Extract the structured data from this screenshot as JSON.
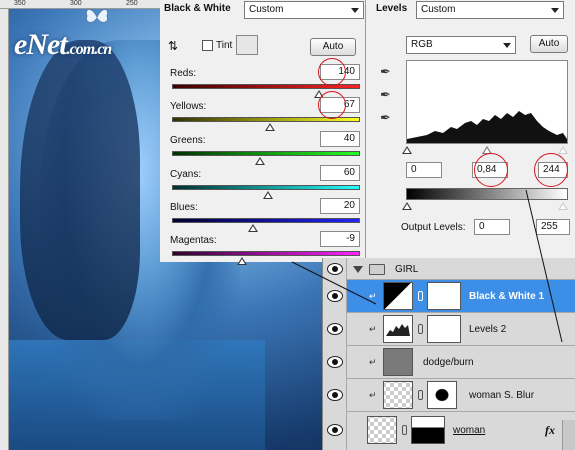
{
  "watermark": {
    "logo": "eNet",
    "domain": ".com.cn"
  },
  "ruler": {
    "ticks": [
      "350",
      "300",
      "250"
    ]
  },
  "bw_panel": {
    "title": "Black & White",
    "preset": "Custom",
    "tint_label": "Tint",
    "auto_label": "Auto",
    "sliders": [
      {
        "label": "Reds:",
        "value": "140",
        "level": 0.78,
        "gradient": [
          "#3a0000",
          "#ff2222"
        ]
      },
      {
        "label": "Yellows:",
        "value": "67",
        "level": 0.52,
        "gradient": [
          "#303000",
          "#ffff22"
        ]
      },
      {
        "label": "Greens:",
        "value": "40",
        "level": 0.47,
        "gradient": [
          "#003000",
          "#22ff22"
        ]
      },
      {
        "label": "Cyans:",
        "value": "60",
        "level": 0.51,
        "gradient": [
          "#003030",
          "#22ffff"
        ]
      },
      {
        "label": "Blues:",
        "value": "20",
        "level": 0.43,
        "gradient": [
          "#000030",
          "#2222ff"
        ]
      },
      {
        "label": "Magentas:",
        "value": "-9",
        "level": 0.37,
        "gradient": [
          "#300030",
          "#ff22ff"
        ]
      }
    ]
  },
  "levels_panel": {
    "title": "Levels",
    "preset": "Custom",
    "channel": "RGB",
    "auto_label": "Auto",
    "input_black": "0",
    "input_gamma": "0,84",
    "input_white": "244",
    "output_label": "Output Levels:",
    "output_black": "0",
    "output_white": "255"
  },
  "layers": [
    {
      "name": "GIRL",
      "type": "group"
    },
    {
      "name": "Black & White 1",
      "type": "adjustment",
      "selected": true
    },
    {
      "name": "Levels 2",
      "type": "adjustment"
    },
    {
      "name": "dodge/burn",
      "type": "pixel"
    },
    {
      "name": "woman S. Blur",
      "type": "smart"
    },
    {
      "name": "woman",
      "type": "masked"
    }
  ],
  "fx_label": "fx",
  "colors": {
    "selection": "#3d8ee6",
    "annotation": "#d4141b",
    "panel_bg": "#f0f0f0"
  }
}
